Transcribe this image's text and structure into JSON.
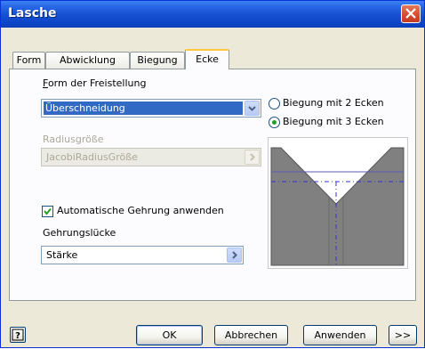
{
  "window": {
    "title": "Lasche"
  },
  "tabs": [
    {
      "label": "Form",
      "active": false
    },
    {
      "label": "Abwicklung",
      "active": false
    },
    {
      "label": "Biegung",
      "active": false
    },
    {
      "label": "Ecke",
      "active": true
    }
  ],
  "corner": {
    "relief_shape_label_first": "F",
    "relief_shape_label_rest": "orm der Freistellung",
    "relief_shape_value": "Überschneidung",
    "radius_label": "Radiusgröße",
    "radius_value": "JacobiRadiusGröße",
    "radio_two_corners": "Biegung mit 2 Ecken",
    "radio_three_corners": "Biegung mit 3 Ecken",
    "selected_radio": "Biegung mit 3 Ecken",
    "auto_miter_label": "Automatische Gehrung anwenden",
    "auto_miter_checked": true,
    "miter_gap_label": "Gehrungslücke",
    "miter_gap_value": "Stärke"
  },
  "buttons": {
    "help": "?",
    "ok": "OK",
    "cancel": "Abbrechen",
    "apply": "Anwenden",
    "more": ">>"
  },
  "colors": {
    "title_bar": "#1752d3",
    "selection": "#316ac5",
    "preview_fill": "#808080",
    "bend_line": "#3333cc"
  }
}
